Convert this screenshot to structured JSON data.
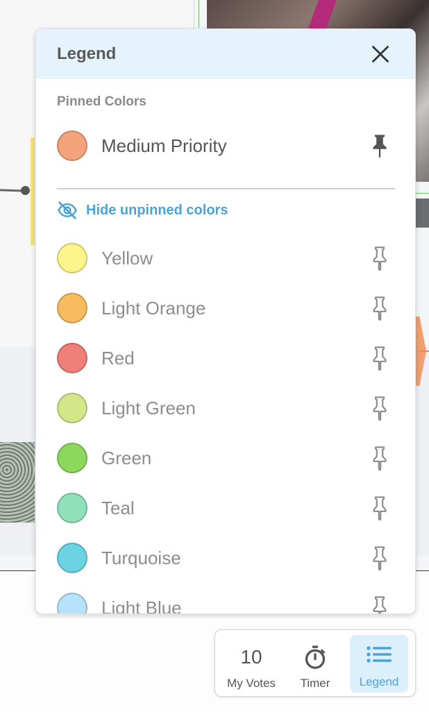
{
  "legend": {
    "title": "Legend",
    "pinned_section_label": "Pinned Colors",
    "pinned": [
      {
        "label": "Medium Priority",
        "color": "#f4a47a"
      }
    ],
    "hide_unpinned_label": "Hide unpinned colors",
    "unpinned": [
      {
        "label": "Yellow",
        "color": "#fdf58c"
      },
      {
        "label": "Light Orange",
        "color": "#f6bc5e"
      },
      {
        "label": "Red",
        "color": "#f07f77"
      },
      {
        "label": "Light Green",
        "color": "#d3e68a"
      },
      {
        "label": "Green",
        "color": "#8cd85d"
      },
      {
        "label": "Teal",
        "color": "#8fe0bb"
      },
      {
        "label": "Turquoise",
        "color": "#6bd3e3"
      },
      {
        "label": "Light Blue",
        "color": "#b7e2fb"
      }
    ]
  },
  "toolbar": {
    "votes_count": "10",
    "votes_label": "My Votes",
    "timer_label": "Timer",
    "legend_label": "Legend"
  },
  "icons": {
    "close": "close-icon",
    "pin_filled": "pin-filled-icon",
    "pin_outline": "pin-outline-icon",
    "eye_slash": "eye-slash-icon",
    "timer": "stopwatch-icon",
    "legend": "list-icon"
  }
}
